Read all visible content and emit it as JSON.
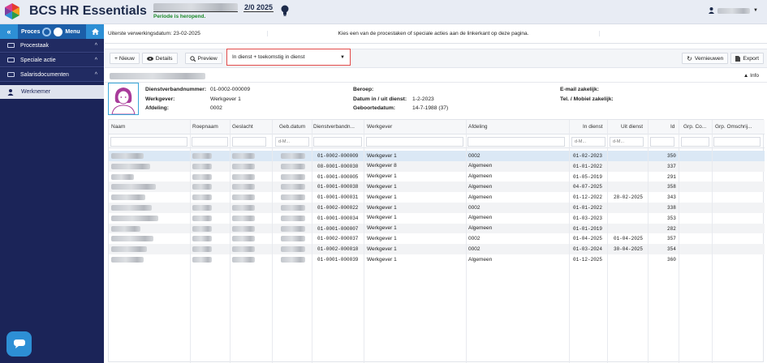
{
  "header": {
    "app_title": "BCS HR Essentials",
    "period_status": "Periode is heropend.",
    "period": "2/0 2025",
    "user_menu_icon": "chevron-down-icon"
  },
  "sidebar": {
    "collapse_label": "«",
    "process_label": "Proces",
    "menu_label": "Menu",
    "items": [
      {
        "label": "Procestaak",
        "chevron": "^"
      },
      {
        "label": "Speciale actie",
        "chevron": "^"
      },
      {
        "label": "Salarisdocumenten",
        "chevron": "^"
      }
    ],
    "active_item": "Werknemer"
  },
  "info_bar": {
    "deadline": "Uiterste verwerkingsdatum: 23-02-2025",
    "instruction": "Kies een van de procestaken of speciale acties aan de linkerkant op deze pagina."
  },
  "toolbar": {
    "new_label": "+ Nieuw",
    "details_label": "Details",
    "preview_label": "Preview",
    "filter_value": "In dienst + toekomstig in dienst",
    "refresh_label": "Vernieuwen",
    "export_label": "Export"
  },
  "employee": {
    "info_label": "▲ Info",
    "dienstverband_label": "Dienstverbandnummer:",
    "dienstverband_value": "01-0002-000009",
    "werkgever_label": "Werkgever:",
    "werkgever_value": "Werkgever 1",
    "afdeling_label": "Afdeling:",
    "afdeling_value": "0002",
    "beroep_label": "Beroep:",
    "datum_label": "Datum in / uit dienst:",
    "datum_value": "1-2-2023",
    "geboorte_label": "Geboortedatum:",
    "geboorte_value": "14-7-1988 (37)",
    "email_label": "E-mail zakelijk:",
    "tel_label": "Tel. / Mobiel zakelijk:"
  },
  "table": {
    "columns": [
      "Naam",
      "Roepnaam",
      "Geslacht",
      "Geb.datum",
      "Dienstverbandn...",
      "Werkgever",
      "Afdeling",
      "In dienst",
      "Uit dienst",
      "Id",
      "Grp. Co...",
      "Grp. Omschrij..."
    ],
    "date_placeholder": "d-M...",
    "rows": [
      {
        "dv": "01-0002-000009",
        "werkgever": "Werkgever 1",
        "afdeling": "0002",
        "in": "01-02-2023",
        "uit": "",
        "id": "350"
      },
      {
        "dv": "08-0001-000030",
        "werkgever": "Werkgever 8",
        "afdeling": "Algemeen",
        "in": "01-01-2022",
        "uit": "",
        "id": "337"
      },
      {
        "dv": "01-0001-000005",
        "werkgever": "Werkgever 1",
        "afdeling": "Algemeen",
        "in": "01-05-2019",
        "uit": "",
        "id": "291"
      },
      {
        "dv": "01-0001-000038",
        "werkgever": "Werkgever 1",
        "afdeling": "Algemeen",
        "in": "04-07-2025",
        "uit": "",
        "id": "358"
      },
      {
        "dv": "01-0001-000031",
        "werkgever": "Werkgever 1",
        "afdeling": "Algemeen",
        "in": "01-12-2022",
        "uit": "28-02-2025",
        "id": "343"
      },
      {
        "dv": "01-0002-000022",
        "werkgever": "Werkgever 1",
        "afdeling": "0002",
        "in": "01-01-2022",
        "uit": "",
        "id": "338"
      },
      {
        "dv": "01-0001-000034",
        "werkgever": "Werkgever 1",
        "afdeling": "Algemeen",
        "in": "01-03-2023",
        "uit": "",
        "id": "353"
      },
      {
        "dv": "01-0001-000007",
        "werkgever": "Werkgever 1",
        "afdeling": "Algemeen",
        "in": "01-01-2019",
        "uit": "",
        "id": "282"
      },
      {
        "dv": "01-0002-000037",
        "werkgever": "Werkgever 1",
        "afdeling": "0002",
        "in": "01-04-2025",
        "uit": "01-04-2025",
        "id": "357"
      },
      {
        "dv": "01-0002-000010",
        "werkgever": "Werkgever 1",
        "afdeling": "0002",
        "in": "01-03-2024",
        "uit": "30-04-2025",
        "id": "354"
      },
      {
        "dv": "01-0001-000039",
        "werkgever": "Werkgever 1",
        "afdeling": "Algemeen",
        "in": "01-12-2025",
        "uit": "",
        "id": "360"
      }
    ]
  },
  "colors": {
    "sidebar": "#1b2458",
    "accent": "#2d8fd5",
    "status_green": "#1c8a2a",
    "filter_border": "#e24a4a"
  }
}
